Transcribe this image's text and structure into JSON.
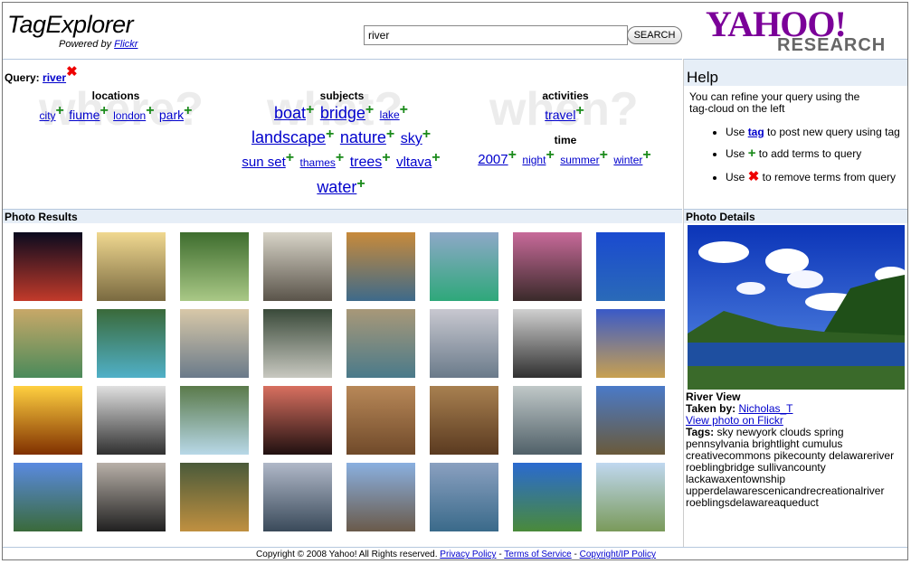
{
  "header": {
    "app_title": "TagExplorer",
    "powered_by": "Powered by",
    "powered_link": "Flickr",
    "search_value": "river",
    "search_button": "SEARCH",
    "brand_top": "YAHOO!",
    "brand_bottom": "RESEARCH"
  },
  "query": {
    "label": "Query:",
    "term": "river",
    "remove": "✖"
  },
  "tagcloud": {
    "watermarks": [
      "where?",
      "what?",
      "when?"
    ],
    "locations": {
      "heading": "locations",
      "tags": [
        "city",
        "fiume",
        "london",
        "park"
      ]
    },
    "subjects": {
      "heading": "subjects",
      "rows": [
        [
          "boat",
          "bridge",
          "lake"
        ],
        [
          "landscape",
          "nature",
          "sky"
        ],
        [
          "sun set",
          "thames",
          "trees",
          "vltava"
        ],
        [
          "water"
        ]
      ]
    },
    "activities": {
      "heading": "activities",
      "tags": [
        "travel"
      ]
    },
    "time": {
      "heading": "time",
      "tags": [
        "2007",
        "night",
        "summer",
        "winter"
      ]
    },
    "plus": "+"
  },
  "help": {
    "title": "Help",
    "intro": "You can refine your query using the tag-cloud on the left",
    "items": [
      {
        "pre": "Use",
        "link": "tag",
        "post": "to post new query using tag"
      },
      {
        "pre": "Use",
        "symbol": "+",
        "post": "to add terms to query"
      },
      {
        "pre": "Use",
        "symbol": "✖",
        "post": "to remove terms from query"
      }
    ]
  },
  "photo_results": {
    "title": "Photo Results",
    "thumbs": [
      {
        "top": "#0a0a1e",
        "bottom": "#c23a2a"
      },
      {
        "top": "#f0d890",
        "bottom": "#7a6a40"
      },
      {
        "top": "#3e6d2e",
        "bottom": "#a9c886"
      },
      {
        "top": "#d8d4c8",
        "bottom": "#5a544a"
      },
      {
        "top": "#c88a3a",
        "bottom": "#3e6a8a"
      },
      {
        "top": "#8ea8c8",
        "bottom": "#2ea87a"
      },
      {
        "top": "#c86a9a",
        "bottom": "#3a2a2a"
      },
      {
        "top": "#1a4ad0",
        "bottom": "#2a6ab8"
      },
      {
        "top": "#c8a868",
        "bottom": "#4a8a5a"
      },
      {
        "top": "#3a6a3a",
        "bottom": "#50b0c8"
      },
      {
        "top": "#d8c8a8",
        "bottom": "#6a7a8a"
      },
      {
        "top": "#3a4a3a",
        "bottom": "#c8c8c0"
      },
      {
        "top": "#a89878",
        "bottom": "#4a7a8a"
      },
      {
        "top": "#c8c8d0",
        "bottom": "#6a7a8a"
      },
      {
        "top": "#d0d0d0",
        "bottom": "#303030"
      },
      {
        "top": "#3a5ac8",
        "bottom": "#c8a050"
      },
      {
        "top": "#ffd040",
        "bottom": "#803000"
      },
      {
        "top": "#e0e0e0",
        "bottom": "#303030"
      },
      {
        "top": "#5a7a4a",
        "bottom": "#b8d8e8"
      },
      {
        "top": "#d87060",
        "bottom": "#201010"
      },
      {
        "top": "#b88858",
        "bottom": "#704a2a"
      },
      {
        "top": "#a88050",
        "bottom": "#5a3a20"
      },
      {
        "top": "#c0c8c8",
        "bottom": "#506068"
      },
      {
        "top": "#4a7ac8",
        "bottom": "#6a5a3a"
      },
      {
        "top": "#5a8ae0",
        "bottom": "#3a6a3a"
      },
      {
        "top": "#b8b0a8",
        "bottom": "#202020"
      },
      {
        "top": "#4a5a3a",
        "bottom": "#c09040"
      },
      {
        "top": "#b0b8c8",
        "bottom": "#3a4a5a"
      },
      {
        "top": "#8ab0e0",
        "bottom": "#6a5a4a"
      },
      {
        "top": "#8aa0c0",
        "bottom": "#3a6a8a"
      },
      {
        "top": "#2a6ad0",
        "bottom": "#4a8a3a"
      },
      {
        "top": "#c0d8f0",
        "bottom": "#7a9a5a"
      }
    ]
  },
  "photo_details": {
    "title": "Photo Details",
    "photo_name": "River View",
    "taken_by_label": "Taken by:",
    "taken_by": "Nicholas_T",
    "view_link": "View photo on Flickr",
    "tags_label": "Tags:",
    "tags": "sky newyork clouds spring pennsylvania brightlight cumulus creativecommons pikecounty delawareriver roeblingbridge sullivancounty lackawaxentownship upperdelawarescenicandrecreationalriver roeblingsdelawareaqueduct"
  },
  "footer": {
    "copyright": "Copyright © 2008 Yahoo! All Rights reserved.",
    "links": [
      "Privacy Policy",
      "Terms of Service",
      "Copyright/IP Policy"
    ],
    "separator": "-"
  }
}
